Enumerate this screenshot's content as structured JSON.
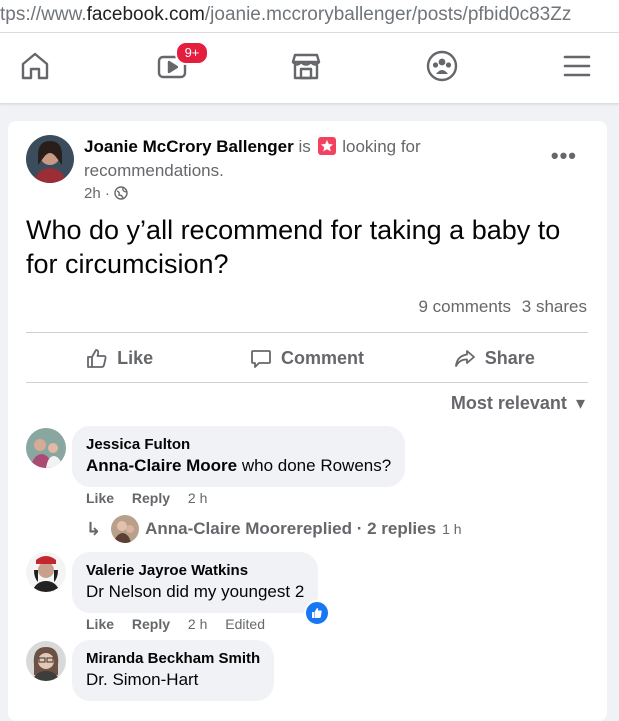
{
  "url": {
    "prefix": "tps://www.",
    "host": "facebook.com",
    "path": "/joanie.mccroryballenger/posts/pfbid0c83Zz"
  },
  "nav": {
    "video_badge": "9+"
  },
  "post": {
    "author": "Joanie McCrory Ballenger",
    "activity_prefix": "is",
    "activity": "looking for recommendations.",
    "time": "2h",
    "privacy_separator": "·",
    "text": "Who do y’all recommend for taking a baby to for circumcision?",
    "comments_count": "9 comments",
    "shares_count": "3 shares",
    "actions": {
      "like": "Like",
      "comment": "Comment",
      "share": "Share"
    },
    "more": "•••"
  },
  "sort": {
    "label": "Most relevant",
    "chevron": "▾"
  },
  "comments": [
    {
      "author": "Jessica Fulton",
      "mention": "Anna-Claire Moore",
      "text": " who done Rowens?",
      "like": "Like",
      "reply": "Reply",
      "time": "2 h",
      "reply_summary": {
        "name": "Anna-Claire Moore",
        "text": " replied · 2 replies",
        "time": "1 h"
      }
    },
    {
      "author": "Valerie Jayroe Watkins",
      "text": "Dr Nelson did my youngest 2",
      "like": "Like",
      "reply": "Reply",
      "time": "2 h",
      "edited": "Edited"
    },
    {
      "author": "Miranda Beckham Smith",
      "text": "Dr. Simon-Hart"
    }
  ],
  "colors": {
    "accent": "#1877f2",
    "badge": "#e41e3f",
    "activity_icon": "#f3425f",
    "secondary_text": "#65676b"
  },
  "icons": [
    "home-icon",
    "video-icon",
    "marketplace-icon",
    "groups-icon",
    "menu-icon",
    "globe-icon",
    "like-icon",
    "comment-icon",
    "share-icon",
    "reply-arrow-icon",
    "like-reaction-icon",
    "activity-star-icon"
  ]
}
